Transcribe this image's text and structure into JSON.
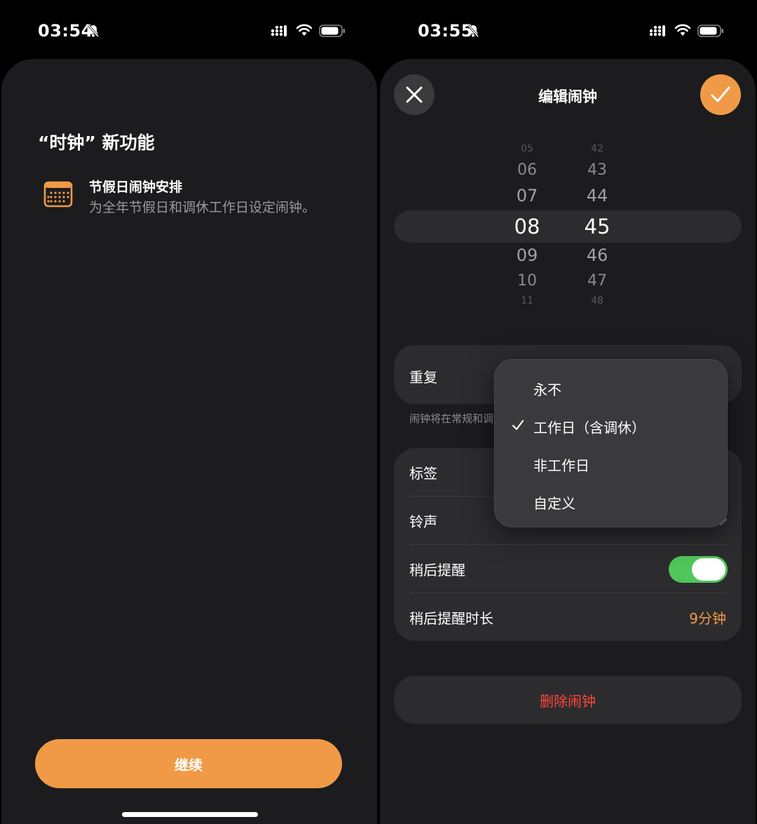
{
  "left_screen": {
    "status_bar": {
      "time": "03:54"
    },
    "whats_new_title": "“时钟” 新功能",
    "feature": {
      "title": "节假日闹钟安排",
      "description": "为全年节假日和调休工作日设定闹钟。",
      "icon": "calendar-icon"
    },
    "continue_label": "继续"
  },
  "right_screen": {
    "status_bar": {
      "time": "03:55"
    },
    "nav": {
      "title": "编辑闹钟",
      "close_icon": "close-icon",
      "confirm_icon": "checkmark-icon"
    },
    "time_picker": {
      "hours": [
        "05",
        "06",
        "07",
        "08",
        "09",
        "10",
        "11"
      ],
      "minutes": [
        "42",
        "43",
        "44",
        "45",
        "46",
        "47",
        "48"
      ],
      "selected_hour": "08",
      "selected_minute": "45"
    },
    "repeat": {
      "label": "重复",
      "footer": "闹钟将在常规和调",
      "menu": [
        {
          "label": "永不",
          "checked": false
        },
        {
          "label": "工作日（含调休）",
          "checked": true
        },
        {
          "label": "非工作日",
          "checked": false
        },
        {
          "label": "自定义",
          "checked": false
        }
      ]
    },
    "settings": {
      "label_row": "标签",
      "sound_row": "铃声",
      "snooze_row": "稍后提醒",
      "snooze_enabled": true,
      "snooze_duration_row": "稍后提醒时长",
      "snooze_duration_value": "9分钟"
    },
    "delete_label": "删除闹钟"
  },
  "colors": {
    "accent_orange": "#f09a47",
    "toggle_green": "#4fc65a",
    "destructive_red": "#ff453a",
    "sheet_bg": "#1c1c1e",
    "group_bg": "#2c2c2e"
  }
}
